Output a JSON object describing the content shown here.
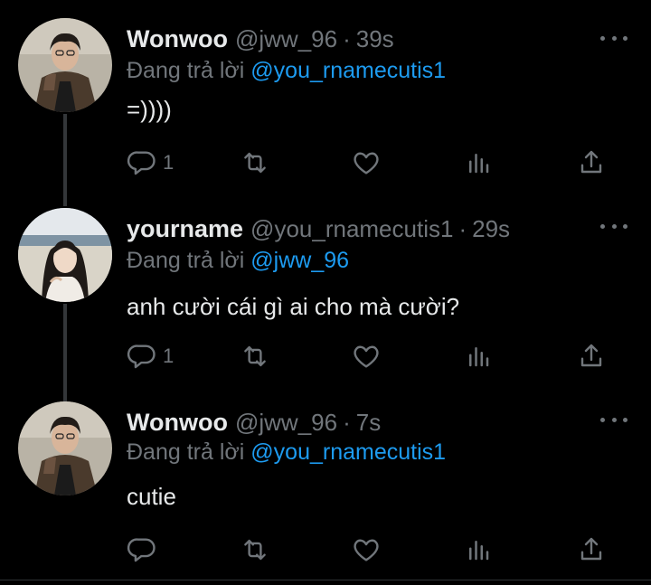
{
  "tweets": [
    {
      "name": "Wonwoo",
      "handle": "@jww_96",
      "separator": "·",
      "time": "39s",
      "replying_prefix": "Đang trả lời",
      "replying_to": "@you_rnamecutis1",
      "text": "=))))",
      "reply_count": "1",
      "avatar_icon": "portrait-man-photo"
    },
    {
      "name": "yourname",
      "handle": "@you_rnamecutis1",
      "separator": "·",
      "time": "29s",
      "replying_prefix": "Đang trả lời",
      "replying_to": "@jww_96",
      "text": "anh cười cái gì ai cho mà cười?",
      "reply_count": "1",
      "avatar_icon": "portrait-woman-beach-photo"
    },
    {
      "name": "Wonwoo",
      "handle": "@jww_96",
      "separator": "·",
      "time": "7s",
      "replying_prefix": "Đang trả lời",
      "replying_to": "@you_rnamecutis1",
      "text": "cutie",
      "reply_count": "",
      "avatar_icon": "portrait-man-photo"
    }
  ],
  "colors": {
    "background": "#000000",
    "text": "#e7e9ea",
    "secondary": "#71767b",
    "link": "#1d9bf0",
    "thread_line": "#333639"
  },
  "icons": [
    "reply-icon",
    "retweet-icon",
    "like-icon",
    "views-icon",
    "share-icon",
    "more-icon"
  ]
}
